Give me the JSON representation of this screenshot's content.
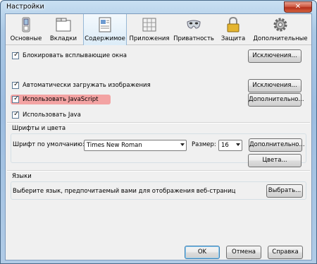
{
  "window": {
    "title": "Настройки",
    "close_label": "✕"
  },
  "tabs": [
    {
      "label": "Основные",
      "icon": "switch-icon"
    },
    {
      "label": "Вкладки",
      "icon": "tabs-icon"
    },
    {
      "label": "Содержимое",
      "icon": "content-icon",
      "active": true
    },
    {
      "label": "Приложения",
      "icon": "applications-icon"
    },
    {
      "label": "Приватность",
      "icon": "privacy-mask-icon"
    },
    {
      "label": "Защита",
      "icon": "lock-icon"
    },
    {
      "label": "Дополнительные",
      "icon": "gear-icon"
    }
  ],
  "content": {
    "block_popups": {
      "label": "Блокировать всплывающие окна",
      "checked": true
    },
    "load_images": {
      "label": "Автоматически загружать изображения",
      "checked": true
    },
    "enable_js": {
      "label": "Использовать JavaScript",
      "checked": true
    },
    "enable_java": {
      "label": "Использовать Java",
      "checked": true
    },
    "exceptions1": "Исключения...",
    "exceptions2": "Исключения...",
    "advanced_js": "Дополнительно...",
    "fonts": {
      "title": "Шрифты и цвета",
      "default_font_label": "Шрифт по умолчанию:",
      "default_font_value": "Times New Roman",
      "size_label": "Размер:",
      "size_value": "16",
      "advanced": "Дополнительно...",
      "colors": "Цвета..."
    },
    "languages": {
      "title": "Языки",
      "description": "Выберите язык, предпочитаемый вами для отображения веб-страниц",
      "choose": "Выбрать..."
    }
  },
  "footer": {
    "ok": "OK",
    "cancel": "Отмена",
    "help": "Справка"
  },
  "colors": {
    "highlight": "#f3a3a3",
    "title_bar": "#9dbde0",
    "close": "#c0392b"
  }
}
